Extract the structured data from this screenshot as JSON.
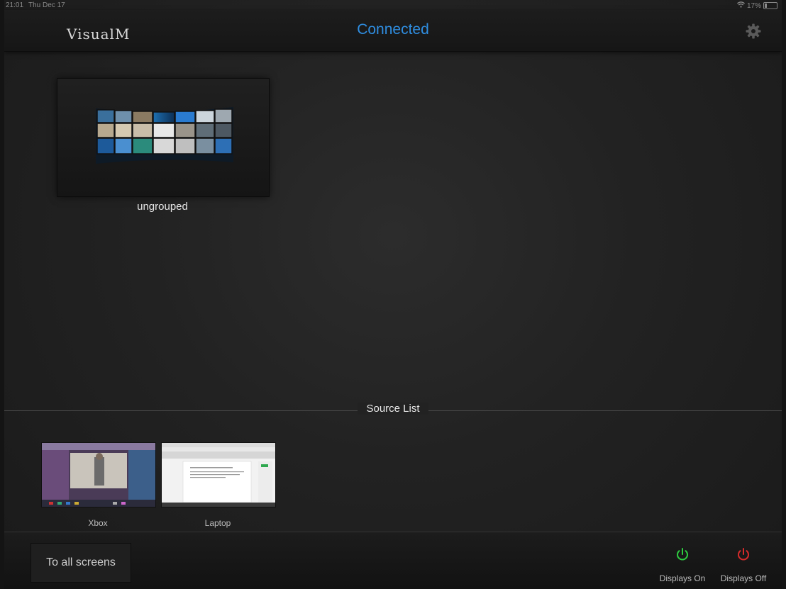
{
  "status_bar": {
    "time": "21:01",
    "date": "Thu Dec 17",
    "battery": "17%"
  },
  "header": {
    "app_title": "VisualM",
    "connection_status": "Connected",
    "settings_icon": "gear-icon",
    "accent_color": "#2f8de0"
  },
  "groups": [
    {
      "label": "ungrouped"
    }
  ],
  "source_list": {
    "title": "Source List",
    "sources": [
      {
        "label": "Xbox"
      },
      {
        "label": "Laptop"
      }
    ]
  },
  "bottom_bar": {
    "to_all_label": "To all screens",
    "displays_on_label": "Displays On",
    "displays_off_label": "Displays Off",
    "on_color": "#2ecc40",
    "off_color": "#d62b2b"
  }
}
